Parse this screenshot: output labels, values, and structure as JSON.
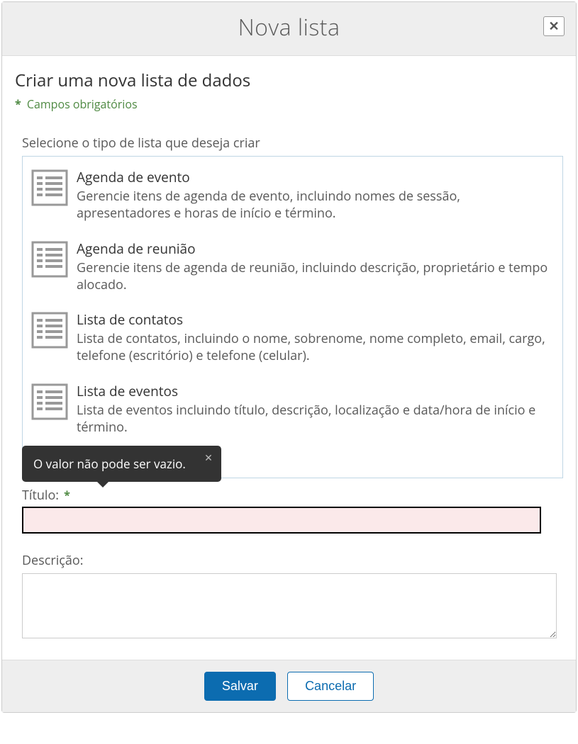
{
  "dialog": {
    "title": "Nova lista",
    "close_glyph": "✕"
  },
  "body": {
    "sub_title": "Criar uma nova lista de dados",
    "required_asterisk": "*",
    "required_note": "Campos obrigatórios",
    "select_label": "Selecione o tipo de lista que deseja criar",
    "list_types": [
      {
        "title": "Agenda de evento",
        "desc": "Gerencie itens de agenda de evento, incluindo nomes de sessão, apresentadores e horas de início e término."
      },
      {
        "title": "Agenda de reunião",
        "desc": "Gerencie itens de agenda de reunião, incluindo descrição, proprietário e tempo alocado."
      },
      {
        "title": "Lista de contatos",
        "desc": "Lista de contatos, incluindo o nome, sobrenome, nome completo, email, cargo, telefone (escritório) e telefone (celular)."
      },
      {
        "title": "Lista de eventos",
        "desc": "Lista de eventos incluindo título, descrição, localização e data/hora de início e término."
      }
    ],
    "tooltip": {
      "message": "O valor não pode ser vazio.",
      "close_glyph": "✕"
    },
    "title_field": {
      "label": "Título:",
      "asterisk": "*",
      "value": ""
    },
    "description_field": {
      "label": "Descrição:",
      "value": ""
    }
  },
  "footer": {
    "save": "Salvar",
    "cancel": "Cancelar"
  }
}
